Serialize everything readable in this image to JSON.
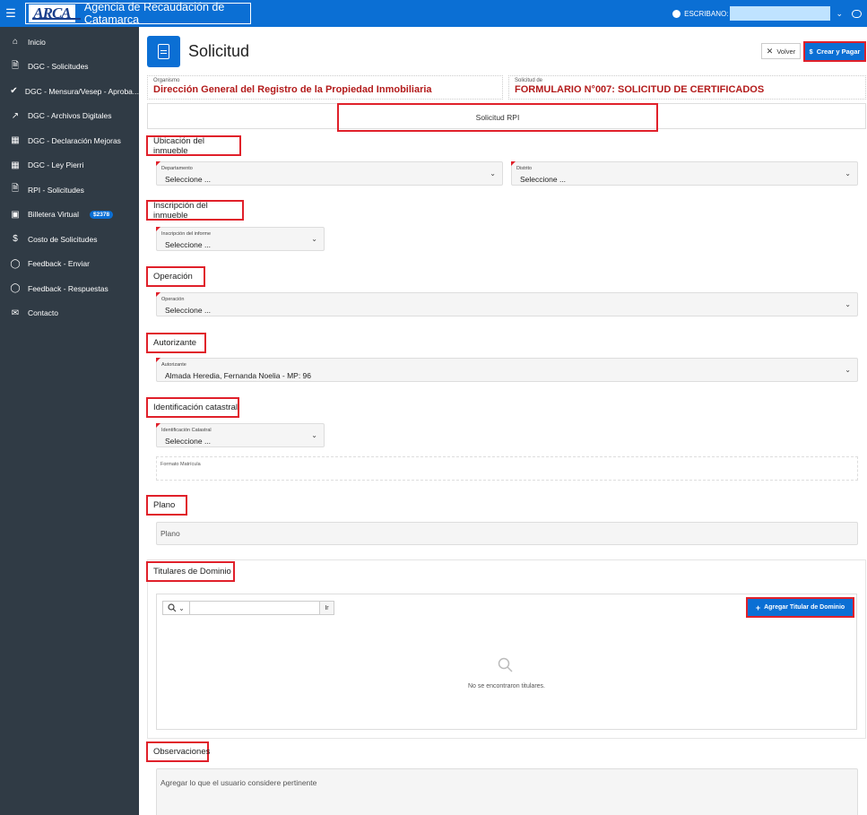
{
  "header": {
    "logo_text": "ARCA",
    "agency": "Agencia de Recaudación de Catamarca",
    "user_label": "ESCRIBANO:"
  },
  "sidebar": {
    "items": [
      {
        "label": "Inicio",
        "icon": "home-icon"
      },
      {
        "label": "DGC - Solicitudes",
        "icon": "document-icon"
      },
      {
        "label": "DGC - Mensura/Vesep - Aproba...",
        "icon": "check-circle-icon"
      },
      {
        "label": "DGC - Archivos Digitales",
        "icon": "chart-icon"
      },
      {
        "label": "DGC - Declaración Mejoras",
        "icon": "building-icon"
      },
      {
        "label": "DGC - Ley Pierri",
        "icon": "building-icon"
      },
      {
        "label": "RPI - Solicitudes",
        "icon": "document-icon"
      },
      {
        "label": "Billetera Virtual",
        "icon": "wallet-icon",
        "badge": "$2378"
      },
      {
        "label": "Costo de Solicitudes",
        "icon": "dollar-icon"
      },
      {
        "label": "Feedback - Enviar",
        "icon": "comment-icon"
      },
      {
        "label": "Feedback - Respuestas",
        "icon": "comment-icon"
      },
      {
        "label": "Contacto",
        "icon": "mail-icon"
      }
    ]
  },
  "page": {
    "title": "Solicitud",
    "volver_label": "Volver",
    "crear_label": "Crear y Pagar",
    "organismo_label": "Organismo",
    "organismo_value": "Dirección General del Registro de la Propiedad Inmobiliaria",
    "solicitud_label": "Solicitud de",
    "solicitud_value": "FORMULARIO N°007: SOLICITUD DE CERTIFICADOS",
    "rpi_tab": "Solicitud RPI"
  },
  "sections": {
    "ubicacion": "Ubicación del inmueble",
    "inscripcion": "Inscripción del inmueble",
    "operacion": "Operación",
    "autorizante": "Autorizante",
    "identificacion": "Identificación catastral",
    "plano": "Plano",
    "titulares": "Titulares de Dominio",
    "observaciones": "Observaciones"
  },
  "fields": {
    "departamento": {
      "label": "Departamento",
      "value": "Seleccione ..."
    },
    "distrito": {
      "label": "Distrito",
      "value": "Seleccione ..."
    },
    "inscripcion_informe": {
      "label": "Inscripción del informe",
      "value": "Seleccione ..."
    },
    "operacion": {
      "label": "Operación",
      "value": "Seleccione ..."
    },
    "autorizante": {
      "label": "Autorizante",
      "value": "Almada Heredia, Fernanda Noelia - MP: 96"
    },
    "identificacion_catastral": {
      "label": "Identificación Catastral",
      "value": "Seleccione ..."
    },
    "formato_matricula": {
      "label": "Formato Matrícula"
    },
    "plano": {
      "placeholder": "Plano"
    },
    "observaciones": {
      "placeholder": "Agregar lo que el usuario considere pertinente"
    }
  },
  "titulares": {
    "go_label": "Ir",
    "add_label": "Agregar Titular de Dominio",
    "empty_text": "No se encontraron titulares."
  },
  "colors": {
    "primary": "#0b6fd4",
    "sidebar": "#303b45",
    "highlight": "#e0202a",
    "accent_text": "#b31b1b"
  }
}
